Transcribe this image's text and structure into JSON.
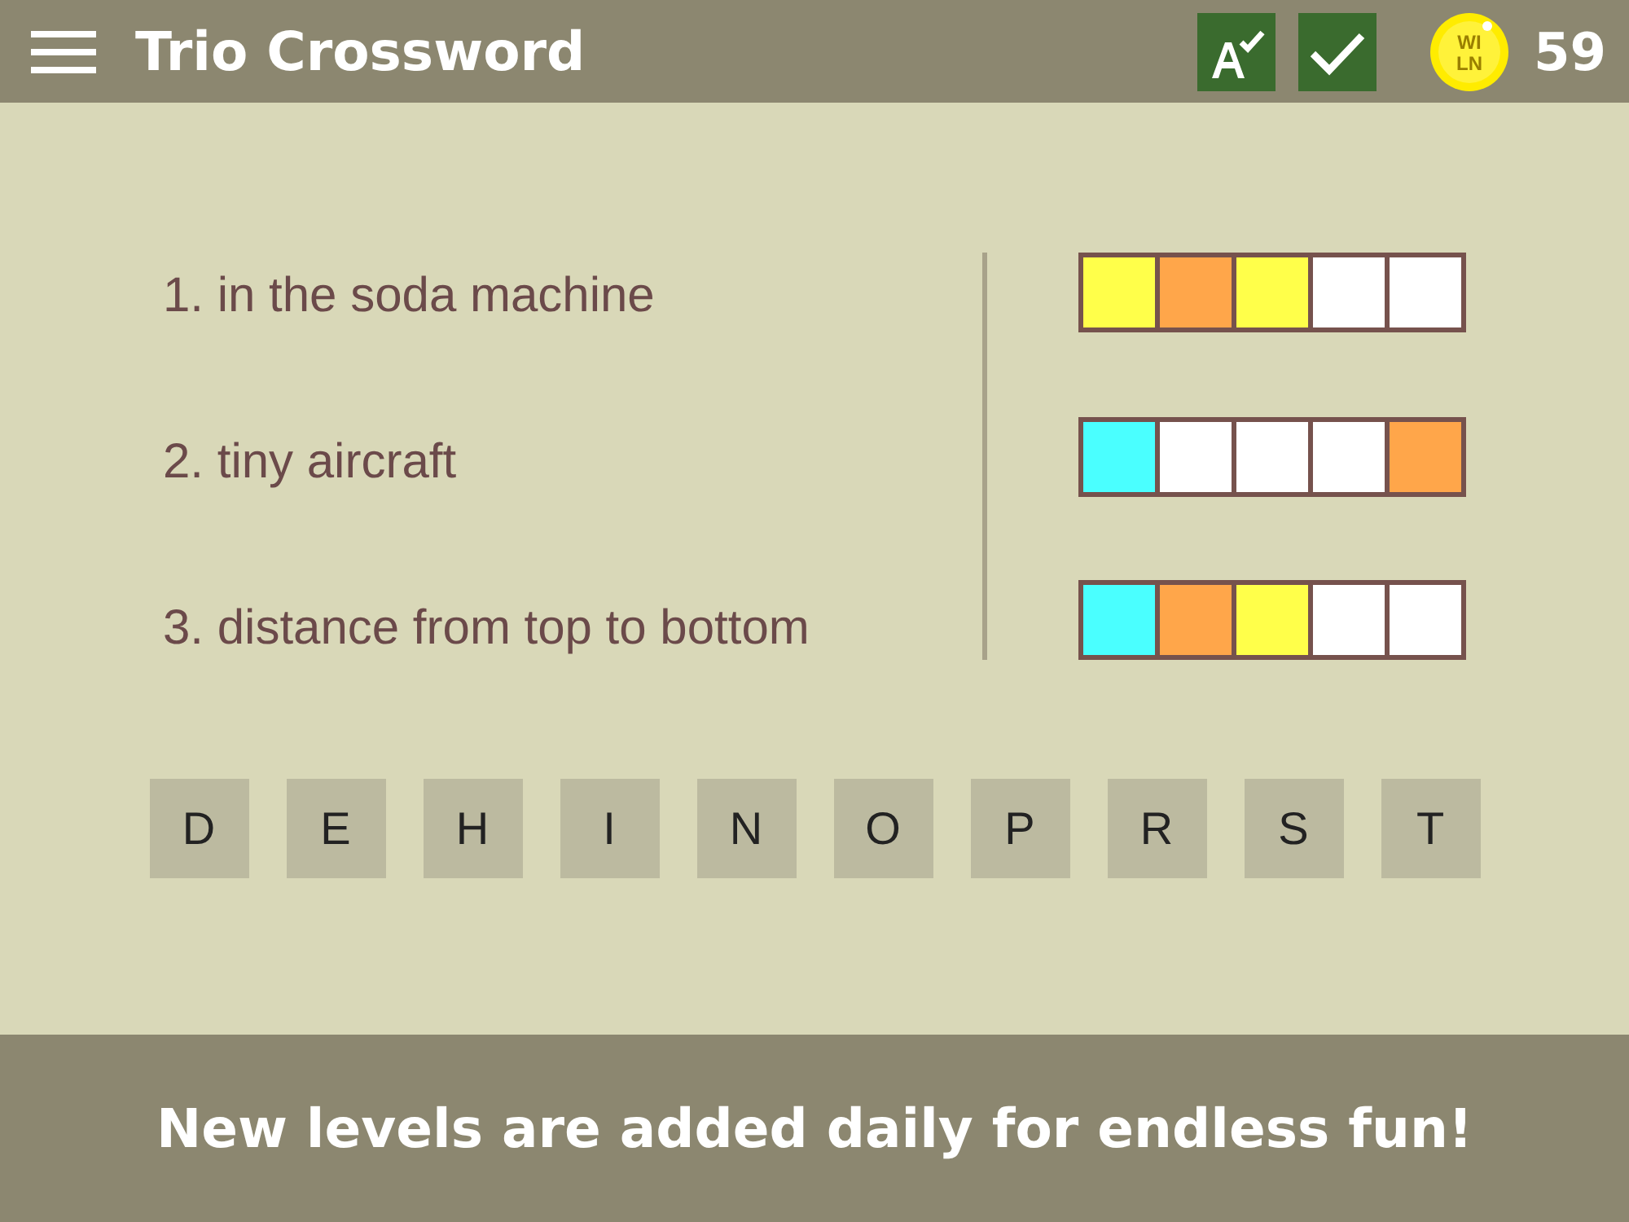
{
  "app_bar": {
    "title": "Trio Crossword",
    "coin": {
      "top": "WI",
      "bottom": "LN"
    },
    "coins": "59"
  },
  "clues": [
    {
      "text": "1. in the soda machine",
      "cells": [
        {
          "color": "#ffff4a"
        },
        {
          "color": "#ffa64a"
        },
        {
          "color": "#ffff4a"
        },
        {
          "color": "#ffffff"
        },
        {
          "color": "#ffffff"
        }
      ]
    },
    {
      "text": "2. tiny aircraft",
      "cells": [
        {
          "color": "#4affff"
        },
        {
          "color": "#ffffff"
        },
        {
          "color": "#ffffff"
        },
        {
          "color": "#ffffff"
        },
        {
          "color": "#ffa64a"
        }
      ]
    },
    {
      "text": "3. distance from top to bottom",
      "cells": [
        {
          "color": "#4affff"
        },
        {
          "color": "#ffa64a"
        },
        {
          "color": "#ffff4a"
        },
        {
          "color": "#ffffff"
        },
        {
          "color": "#ffffff"
        }
      ]
    }
  ],
  "letters": [
    "D",
    "E",
    "H",
    "I",
    "N",
    "O",
    "P",
    "R",
    "S",
    "T"
  ],
  "footer": "New levels are added daily for endless fun!"
}
